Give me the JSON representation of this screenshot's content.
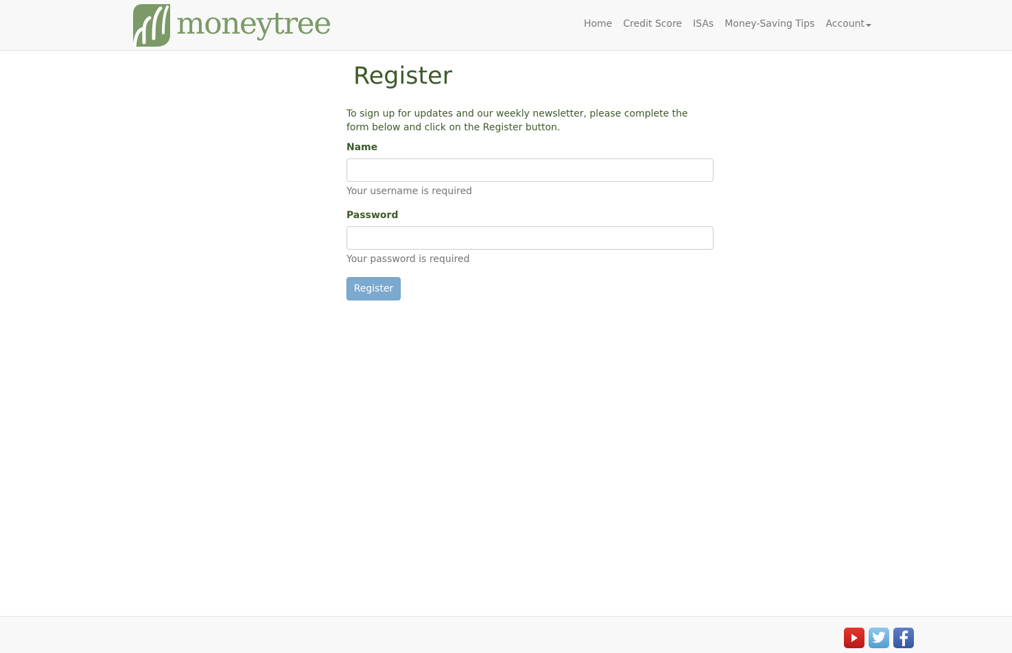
{
  "brand": {
    "name": "moneytree",
    "logo_color": "#7b9a67"
  },
  "nav": {
    "items": [
      {
        "label": "Home"
      },
      {
        "label": "Credit Score"
      },
      {
        "label": "ISAs"
      },
      {
        "label": "Money-Saving Tips"
      },
      {
        "label": "Account",
        "has_dropdown": true
      }
    ]
  },
  "page": {
    "title": "Register",
    "intro": "To sign up for updates and our weekly newsletter, please complete the form below and click on the Register button."
  },
  "form": {
    "name": {
      "label": "Name",
      "value": "",
      "help": "Your username is required"
    },
    "password": {
      "label": "Password",
      "value": "",
      "help": "Your password is required"
    },
    "submit_label": "Register"
  },
  "footer": {
    "social": [
      {
        "icon": "youtube-icon",
        "color": "#d42a22"
      },
      {
        "icon": "twitter-icon",
        "color": "#5ba8d9"
      },
      {
        "icon": "facebook-icon",
        "color": "#3b5ea8"
      }
    ]
  },
  "colors": {
    "text": "#3d5a2a",
    "muted": "#737373",
    "button": "#7ca9cf",
    "navbar_bg": "#f8f8f8"
  }
}
